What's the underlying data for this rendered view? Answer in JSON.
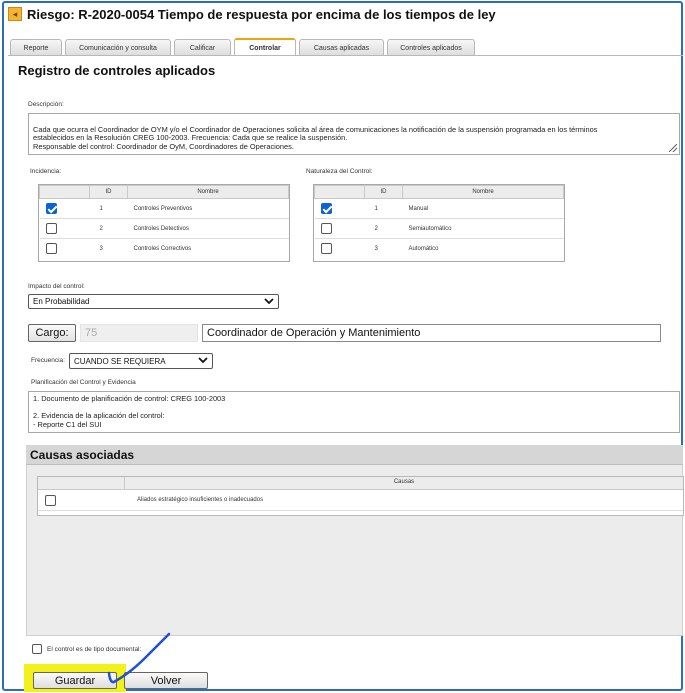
{
  "header": {
    "title": "Riesgo: R-2020-0054 Tiempo de respuesta por encima de los tiempos de ley",
    "back_glyph": "◂"
  },
  "tabs": [
    {
      "label": "Reporte",
      "active": false
    },
    {
      "label": "Comunicación y consulta",
      "active": false
    },
    {
      "label": "Calificar",
      "active": false
    },
    {
      "label": "Controlar",
      "active": true
    },
    {
      "label": "Causas aplicadas",
      "active": false
    },
    {
      "label": "Controles aplicados",
      "active": false
    }
  ],
  "section_title": "Registro de controles aplicados",
  "descripcion": {
    "label": "Descripción:",
    "value": "Cada que ocurra el Coordinador de OYM y/o el Coordinador de Operaciones solicita al área de comunicaciones la notificación de la suspensión programada en los términos\nestablecidos en la Resolución CREG 100-2003. Frecuencia: Cada que se realice la suspensión.\nResponsable del control: Coordinador de OyM, Coordinadores de Operaciones."
  },
  "incidencia": {
    "label": "Incidencia:",
    "columns": [
      "ID",
      "Nombre"
    ],
    "rows": [
      {
        "checked": true,
        "id": "1",
        "nombre": "Controles Preventivos"
      },
      {
        "checked": false,
        "id": "2",
        "nombre": "Controles Detectivos"
      },
      {
        "checked": false,
        "id": "3",
        "nombre": "Controles Correctivos"
      }
    ]
  },
  "naturaleza": {
    "label": "Naturaleza del Control:",
    "columns": [
      "ID",
      "Nombre"
    ],
    "rows": [
      {
        "checked": true,
        "id": "1",
        "nombre": "Manual"
      },
      {
        "checked": false,
        "id": "2",
        "nombre": "Semiautomático"
      },
      {
        "checked": false,
        "id": "3",
        "nombre": "Automático"
      }
    ]
  },
  "impacto": {
    "label": "Impacto del control:",
    "value": "En Probabilidad"
  },
  "cargo": {
    "button_label": "Cargo:",
    "id_value": "75",
    "name_value": "Coordinador de Operación y Mantenimiento"
  },
  "frecuencia": {
    "label": "Frecuencia:",
    "value": "CUANDO SE REQUIERA"
  },
  "planificacion": {
    "label": "Planificación del Control y Evidencia",
    "value": "1. Documento de planificación de control: CREG 100-2003\n\n2. Evidencia de la aplicación del control:\n- Reporte C1 del SUI"
  },
  "causas": {
    "title": "Causas asociadas",
    "column": "Causas",
    "rows": [
      {
        "checked": false,
        "text": "Aliados estratégico insuficientes o inadecuados"
      }
    ]
  },
  "documental": {
    "label": "El control es de tipo documental:",
    "checked": false
  },
  "buttons": {
    "guardar": "Guardar",
    "volver": "Volver"
  },
  "colors": {
    "accent_blue": "#0b62d6",
    "frame_blue": "#2a6cc4",
    "highlight_yellow": "#f2f21a",
    "active_tab_border": "#f0a30a"
  }
}
